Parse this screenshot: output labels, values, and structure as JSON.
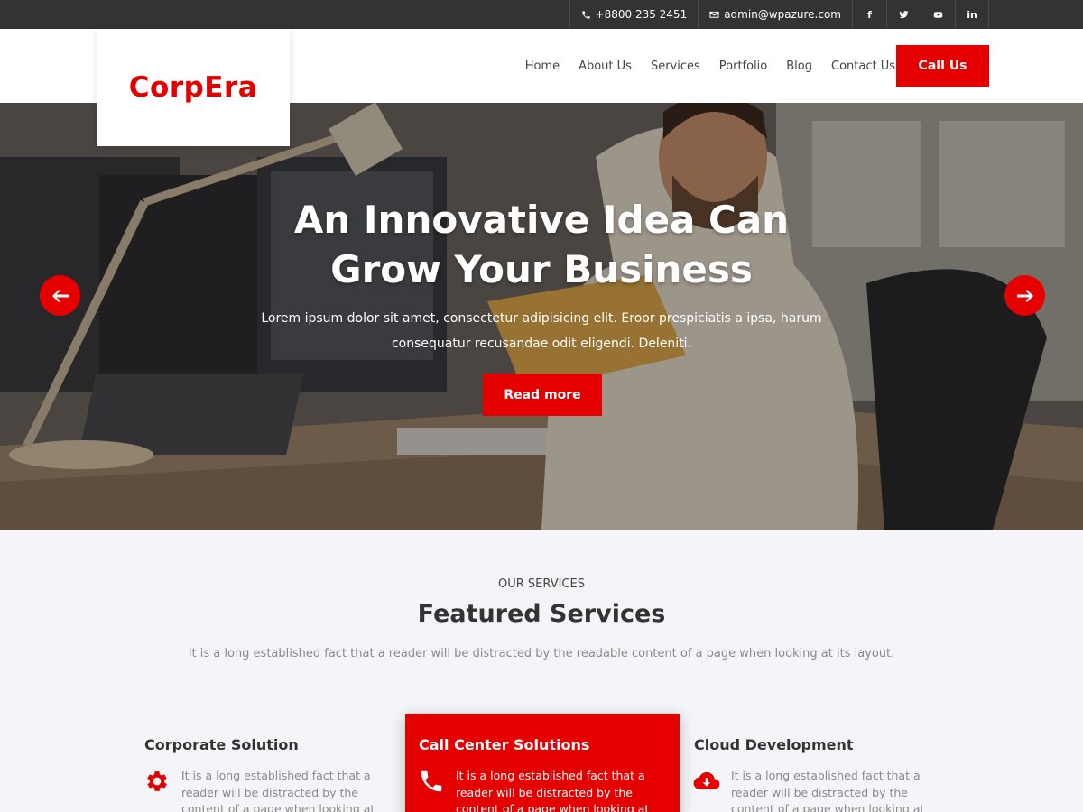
{
  "topbar": {
    "phone": "+8800 235 2451",
    "email": "admin@wpazure.com",
    "social": [
      {
        "icon": "facebook-icon",
        "glyph": "f"
      },
      {
        "icon": "twitter-icon",
        "glyph": ""
      },
      {
        "icon": "youtube-icon",
        "glyph": ""
      },
      {
        "icon": "linkedin-icon",
        "glyph": "in"
      }
    ]
  },
  "header": {
    "logo": "CorpEra",
    "nav": [
      "Home",
      "About Us",
      "Services",
      "Portfolio",
      "Blog",
      "Contact Us"
    ],
    "cta": "Call Us"
  },
  "hero": {
    "title_line1": "An Innovative Idea Can",
    "title_line2": "Grow Your Business",
    "text_line1": "Lorem ipsum dolor sit amet, consectetur adipisicing elit. Eroor prespiciatis a ipsa, harum",
    "text_line2": "consequatur recusandae odit eligendi. Deleniti.",
    "button": "Read more"
  },
  "services": {
    "subtitle": "OUR SERVICES",
    "title": "Featured Services",
    "description": "It is a long established fact that a reader will be distracted by the readable content of a page when looking at its layout.",
    "cards": [
      {
        "title": "Corporate Solution",
        "icon": "gear-icon",
        "text": "It is a long established fact that a reader will be distracted by the content of a page when looking at its"
      },
      {
        "title": "Call Center Solutions",
        "icon": "phone-icon",
        "text": "It is a long established fact that a reader will be distracted by the content of a page when looking at its"
      },
      {
        "title": "Cloud Development",
        "icon": "cloud-download-icon",
        "text": "It is a long established fact that a reader will be distracted by the content of a page when looking at its"
      }
    ]
  },
  "colors": {
    "accent": "#e50000",
    "topbar": "#333333",
    "section_bg": "#f4f5f8"
  }
}
